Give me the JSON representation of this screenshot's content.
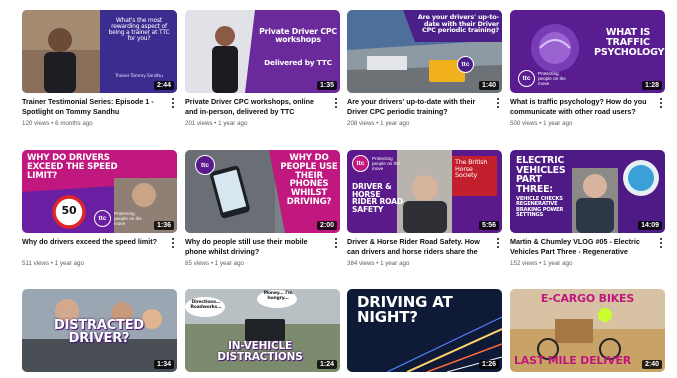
{
  "videos": [
    {
      "title": "Trainer Testimonial Series: Episode 1 - Spotlight on Tommy Sandhu",
      "views": "120 views",
      "age": "6 months ago",
      "duration": "2:44",
      "thumb_text": "What's the most rewarding aspect of being a trainer at TTC for you?",
      "thumb_caption": "Trainer Tommy Sandhu"
    },
    {
      "title": "Private Driver CPC workshops, online and in-person, delivered by TTC",
      "views": "201 views",
      "age": "1 year ago",
      "duration": "1:35",
      "thumb_text": "Private Driver CPC workshops",
      "thumb_text2": "Delivered by TTC"
    },
    {
      "title": "Are your drivers' up-to-date with their Driver CPC periodic training?",
      "views": "208 views",
      "age": "1 year ago",
      "duration": "1:40",
      "thumb_text": "Are your drivers' up-to-date with their Driver CPC periodic training?"
    },
    {
      "title": "What is traffic psychology? How do you communicate with other road users?",
      "views": "500 views",
      "age": "1 year ago",
      "duration": "1:28",
      "thumb_text": "WHAT IS TRAFFIC PSYCHOLOGY?"
    },
    {
      "title": "Why do drivers exceed the speed limit?",
      "views": "511 views",
      "age": "1 year ago",
      "duration": "1:36",
      "thumb_text": "WHY DO DRIVERS EXCEED THE SPEED LIMIT?",
      "thumb_sign": "50"
    },
    {
      "title": "Why do people still use their mobile phone whilst driving?",
      "views": "85 views",
      "age": "1 year ago",
      "duration": "2:00",
      "thumb_text": "WHY DO PEOPLE USE THEIR PHONES WHILST DRIVING?"
    },
    {
      "title": "Driver & Horse Rider Road Safety. How can drivers and horse riders share the road...",
      "views": "384 views",
      "age": "1 year ago",
      "duration": "5:56",
      "thumb_text": "DRIVER & HORSE RIDER ROAD SAFETY",
      "thumb_badge": "The British Horse Society"
    },
    {
      "title": "Martin & Chumley VLOG #05 - Electric Vehicles Part Three - Regenerative braking ...",
      "views": "152 views",
      "age": "1 year ago",
      "duration": "14:09",
      "thumb_text": "ELECTRIC VEHICLES PART THREE:",
      "thumb_text2": "VEHICLE CHECKS REGENERATIVE BRAKING POWER SETTINGS"
    },
    {
      "title": "",
      "views": "",
      "age": "",
      "duration": "1:34",
      "thumb_text": "DISTRACTED DRIVER?"
    },
    {
      "title": "",
      "views": "",
      "age": "",
      "duration": "1:24",
      "thumb_text": "IN-VEHICLE DISTRACTIONS",
      "thumb_bubble1": "Money... I'm hungry...",
      "thumb_bubble2": "Directions... Roadworks..."
    },
    {
      "title": "",
      "views": "",
      "age": "",
      "duration": "1:26",
      "thumb_text": "DRIVING AT NIGHT?"
    },
    {
      "title": "",
      "views": "",
      "age": "",
      "duration": "2:40",
      "thumb_text": "E-CARGO BIKES",
      "thumb_text2": "LAST MILE DELIVER"
    }
  ],
  "brand": {
    "logo": "ttc",
    "tagline": "Protecting people on the move"
  },
  "meta_sep": "•",
  "colors": {
    "purple": "#5b1a8c",
    "magenta": "#c0187f",
    "red": "#e0242b",
    "orange": "#e8632b"
  },
  "icons": [
    "more-vert-icon"
  ]
}
